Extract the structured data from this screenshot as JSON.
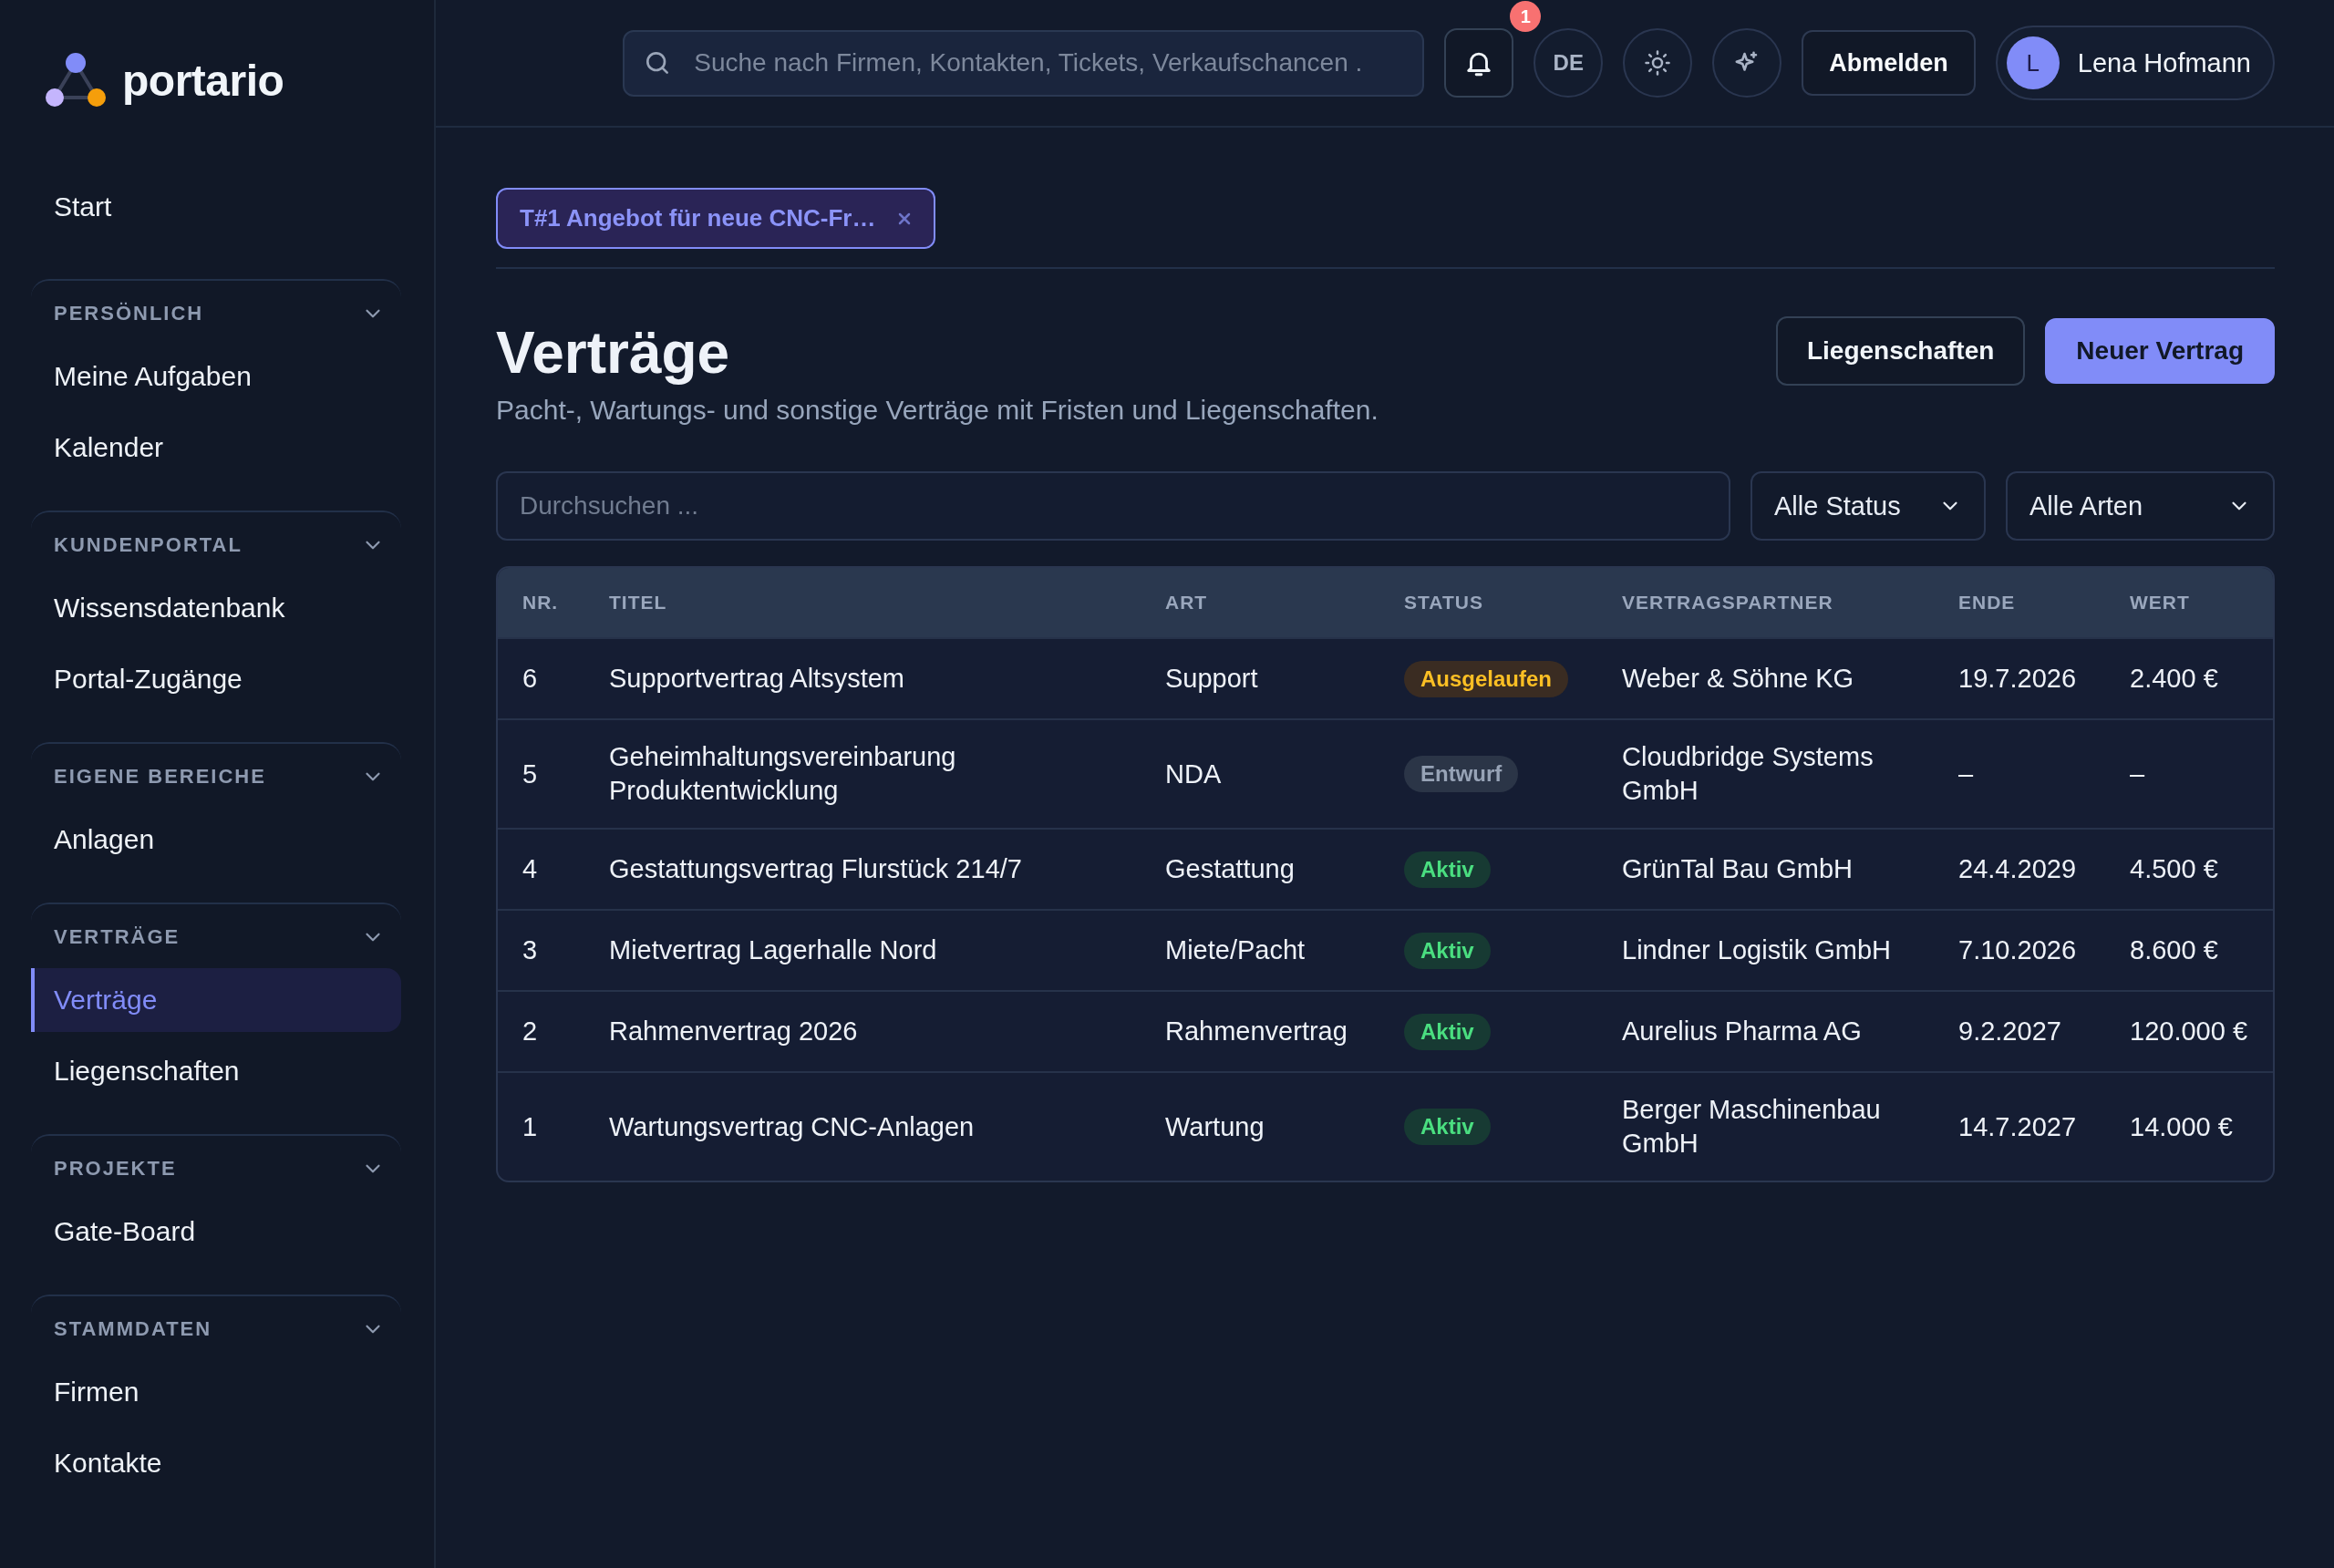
{
  "brand": {
    "name": "portario"
  },
  "sidebar": {
    "start": {
      "label": "Start",
      "selected": false
    },
    "sections": [
      {
        "title": "PERSÖNLICH",
        "expanded": true,
        "items": [
          {
            "label": "Meine Aufgaben",
            "selected": false
          },
          {
            "label": "Kalender",
            "selected": false
          }
        ]
      },
      {
        "title": "KUNDENPORTAL",
        "expanded": true,
        "items": [
          {
            "label": "Wissensdatenbank",
            "selected": false
          },
          {
            "label": "Portal-Zugänge",
            "selected": false
          }
        ]
      },
      {
        "title": "EIGENE BEREICHE",
        "expanded": true,
        "items": [
          {
            "label": "Anlagen",
            "selected": false
          }
        ]
      },
      {
        "title": "VERTRÄGE",
        "expanded": true,
        "items": [
          {
            "label": "Verträge",
            "selected": true
          },
          {
            "label": "Liegenschaften",
            "selected": false
          }
        ]
      },
      {
        "title": "PROJEKTE",
        "expanded": true,
        "items": [
          {
            "label": "Gate-Board",
            "selected": false
          }
        ]
      },
      {
        "title": "STAMMDATEN",
        "expanded": true,
        "items": [
          {
            "label": "Firmen",
            "selected": false
          },
          {
            "label": "Kontakte",
            "selected": false
          }
        ]
      }
    ]
  },
  "topbar": {
    "search": {
      "placeholder": "Suche nach Firmen, Kontakten, Tickets, Verkaufschancen ."
    },
    "notifications": {
      "count": "1"
    },
    "language": "DE",
    "logout": "Abmelden",
    "user": {
      "initial": "L",
      "name": "Lena Hofmann"
    }
  },
  "open_tabs": [
    {
      "label": "T#1 Angebot für neue CNC-Fr…",
      "selected": true
    }
  ],
  "page": {
    "title": "Verträge",
    "subtitle": "Pacht-, Wartungs- und sonstige Verträge mit Fristen und Liegenschaften.",
    "buttons": [
      {
        "label": "Liegenschaften",
        "kind": "secondary"
      },
      {
        "label": "Neuer Vertrag",
        "kind": "primary"
      }
    ]
  },
  "filters": {
    "search": {
      "placeholder": "Durchsuchen ..."
    },
    "selects": [
      {
        "value": "Alle Status"
      },
      {
        "value": "Alle Arten"
      }
    ]
  },
  "table": {
    "columns": [
      "NR.",
      "TITEL",
      "ART",
      "STATUS",
      "VERTRAGSPARTNER",
      "ENDE",
      "WERT"
    ],
    "rows": [
      {
        "nr": "6",
        "titel": "Supportvertrag Altsystem",
        "art": "Support",
        "status": {
          "label": "Ausgelaufen",
          "kind": "expired"
        },
        "partner": "Weber & Söhne KG",
        "ende": "19.7.2026",
        "wert": "2.400 €"
      },
      {
        "nr": "5",
        "titel": "Geheimhaltungsvereinbarung Produktentwicklung",
        "art": "NDA",
        "status": {
          "label": "Entwurf",
          "kind": "draft"
        },
        "partner": "Cloudbridge Systems GmbH",
        "ende": "–",
        "wert": "–"
      },
      {
        "nr": "4",
        "titel": "Gestattungsvertrag Flurstück 214/7",
        "art": "Gestattung",
        "status": {
          "label": "Aktiv",
          "kind": "active"
        },
        "partner": "GrünTal Bau GmbH",
        "ende": "24.4.2029",
        "wert": "4.500 €"
      },
      {
        "nr": "3",
        "titel": "Mietvertrag Lagerhalle Nord",
        "art": "Miete/Pacht",
        "status": {
          "label": "Aktiv",
          "kind": "active"
        },
        "partner": "Lindner Logistik GmbH",
        "ende": "7.10.2026",
        "wert": "8.600 €"
      },
      {
        "nr": "2",
        "titel": "Rahmenvertrag 2026",
        "art": "Rahmenvertrag",
        "status": {
          "label": "Aktiv",
          "kind": "active"
        },
        "partner": "Aurelius Pharma AG",
        "ende": "9.2.2027",
        "wert": "120.000 €"
      },
      {
        "nr": "1",
        "titel": "Wartungsvertrag CNC-Anlagen",
        "art": "Wartung",
        "status": {
          "label": "Aktiv",
          "kind": "active"
        },
        "partner": "Berger Maschinenbau GmbH",
        "ende": "14.7.2027",
        "wert": "14.000 €"
      }
    ]
  }
}
